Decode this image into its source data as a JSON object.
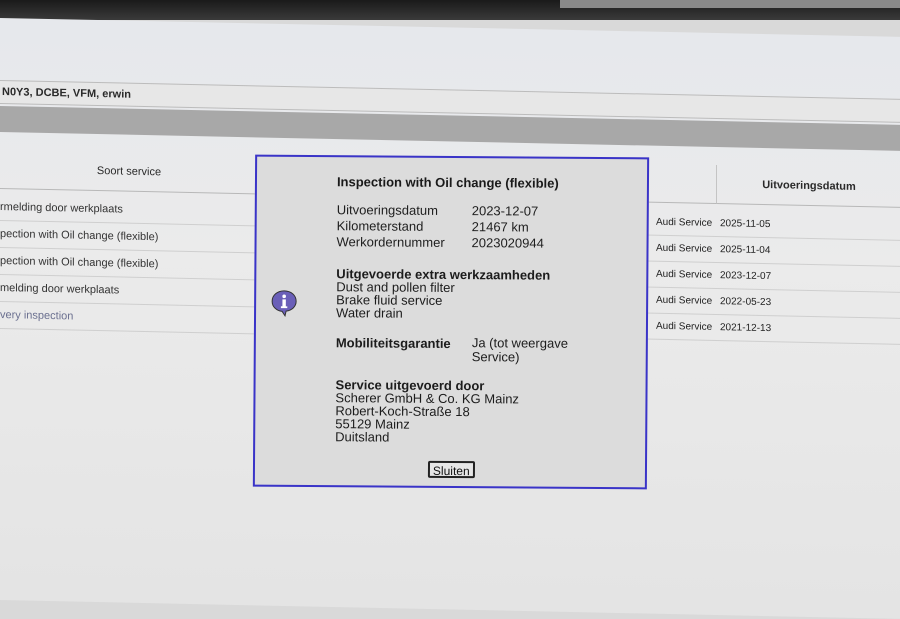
{
  "header": {
    "user_line": "N0Y3, DCBE, VFM, erwin"
  },
  "table": {
    "col_service_type": "Soort service",
    "col_execution_date": "Uitvoeringsdatum",
    "left_rows": [
      "rmelding door werkplaats",
      "pection with Oil change (flexible)",
      "pection with Oil change (flexible)",
      "melding door werkplaats",
      "very inspection"
    ],
    "right_rows": [
      {
        "type": "Audi Service",
        "date": "2025-11-05"
      },
      {
        "type": "Audi Service",
        "date": "2025-11-04"
      },
      {
        "type": "Audi Service",
        "date": "2023-12-07"
      },
      {
        "type": "Audi Service",
        "date": "2022-05-23"
      },
      {
        "type": "Audi Service",
        "date": "2021-12-13"
      }
    ]
  },
  "dialog": {
    "title": "Inspection with Oil change (flexible)",
    "icon": "info-icon",
    "fields": [
      {
        "label": "Uitvoeringsdatum",
        "value": "2023-12-07"
      },
      {
        "label": "Kilometerstand",
        "value": "21467 km"
      },
      {
        "label": "Werkordernummer",
        "value": "2023020944"
      }
    ],
    "extra_work_title": "Uitgevoerde extra werkzaamheden",
    "extra_work": [
      "Dust and pollen filter",
      "Brake fluid service",
      "Water drain"
    ],
    "mobility_label": "Mobiliteitsgarantie",
    "mobility_value": "Ja (tot weergave Service)",
    "performed_by_title": "Service uitgevoerd door",
    "performed_by": [
      "Scherer GmbH & Co. KG Mainz",
      "Robert-Koch-Straße 18",
      "55129 Mainz",
      "Duitsland"
    ],
    "close_label": "Sluiten"
  },
  "colors": {
    "dialog_border": "#3a34c8",
    "icon_fill": "#6a5fb8"
  }
}
